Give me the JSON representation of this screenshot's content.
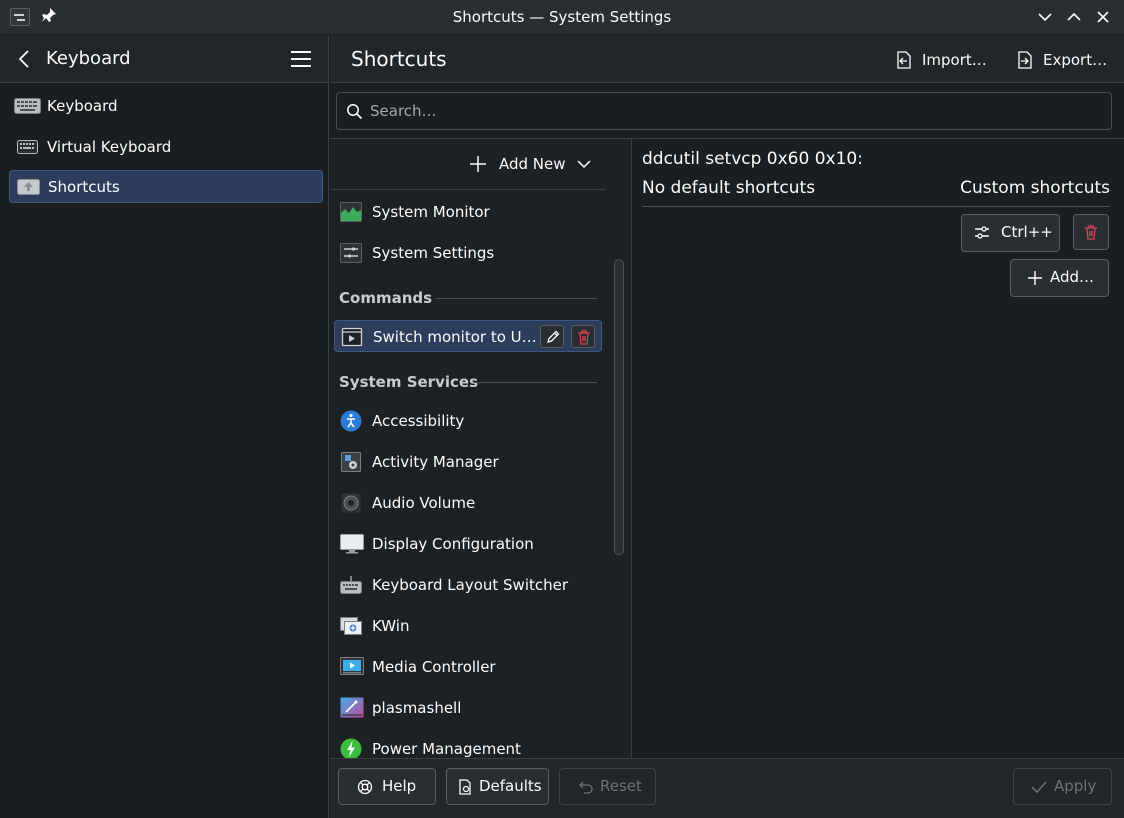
{
  "window": {
    "title": "Shortcuts — System Settings"
  },
  "sidebar": {
    "header_title": "Keyboard",
    "items": [
      {
        "label": "Keyboard",
        "icon": "keyboard-icon"
      },
      {
        "label": "Virtual Keyboard",
        "icon": "virtual-keyboard-icon"
      },
      {
        "label": "Shortcuts",
        "icon": "shortcuts-icon",
        "active": true
      }
    ]
  },
  "main": {
    "title": "Shortcuts",
    "import_label": "Import…",
    "export_label": "Export…",
    "search_placeholder": "Search…"
  },
  "list": {
    "add_new_label": "Add New",
    "top_items": [
      {
        "label": "System Monitor",
        "icon": "system-monitor-icon"
      },
      {
        "label": "System Settings",
        "icon": "system-settings-icon"
      }
    ],
    "commands_section": "Commands",
    "commands": [
      {
        "label": "Switch monitor to U…",
        "icon": "command-icon",
        "active": true
      }
    ],
    "services_section": "System Services",
    "services": [
      {
        "label": "Accessibility",
        "icon": "accessibility-icon"
      },
      {
        "label": "Activity Manager",
        "icon": "activity-manager-icon"
      },
      {
        "label": "Audio Volume",
        "icon": "audio-volume-icon"
      },
      {
        "label": "Display Configuration",
        "icon": "display-icon"
      },
      {
        "label": "Keyboard Layout Switcher",
        "icon": "keyboard-layout-icon"
      },
      {
        "label": "KWin",
        "icon": "kwin-icon"
      },
      {
        "label": "Media Controller",
        "icon": "media-controller-icon"
      },
      {
        "label": "plasmashell",
        "icon": "plasmashell-icon"
      },
      {
        "label": "Power Management",
        "icon": "power-management-icon"
      }
    ]
  },
  "details": {
    "title": "ddcutil setvcp 0x60 0x10:",
    "no_default": "No default shortcuts",
    "custom_header": "Custom shortcuts",
    "shortcut_label": "Ctrl++",
    "add_label": "Add…"
  },
  "footer": {
    "help_label": "Help",
    "defaults_label": "Defaults",
    "reset_label": "Reset",
    "apply_label": "Apply"
  },
  "colors": {
    "accent": "#3d5a87",
    "delete": "#da4453",
    "background": "#1b1e20"
  }
}
